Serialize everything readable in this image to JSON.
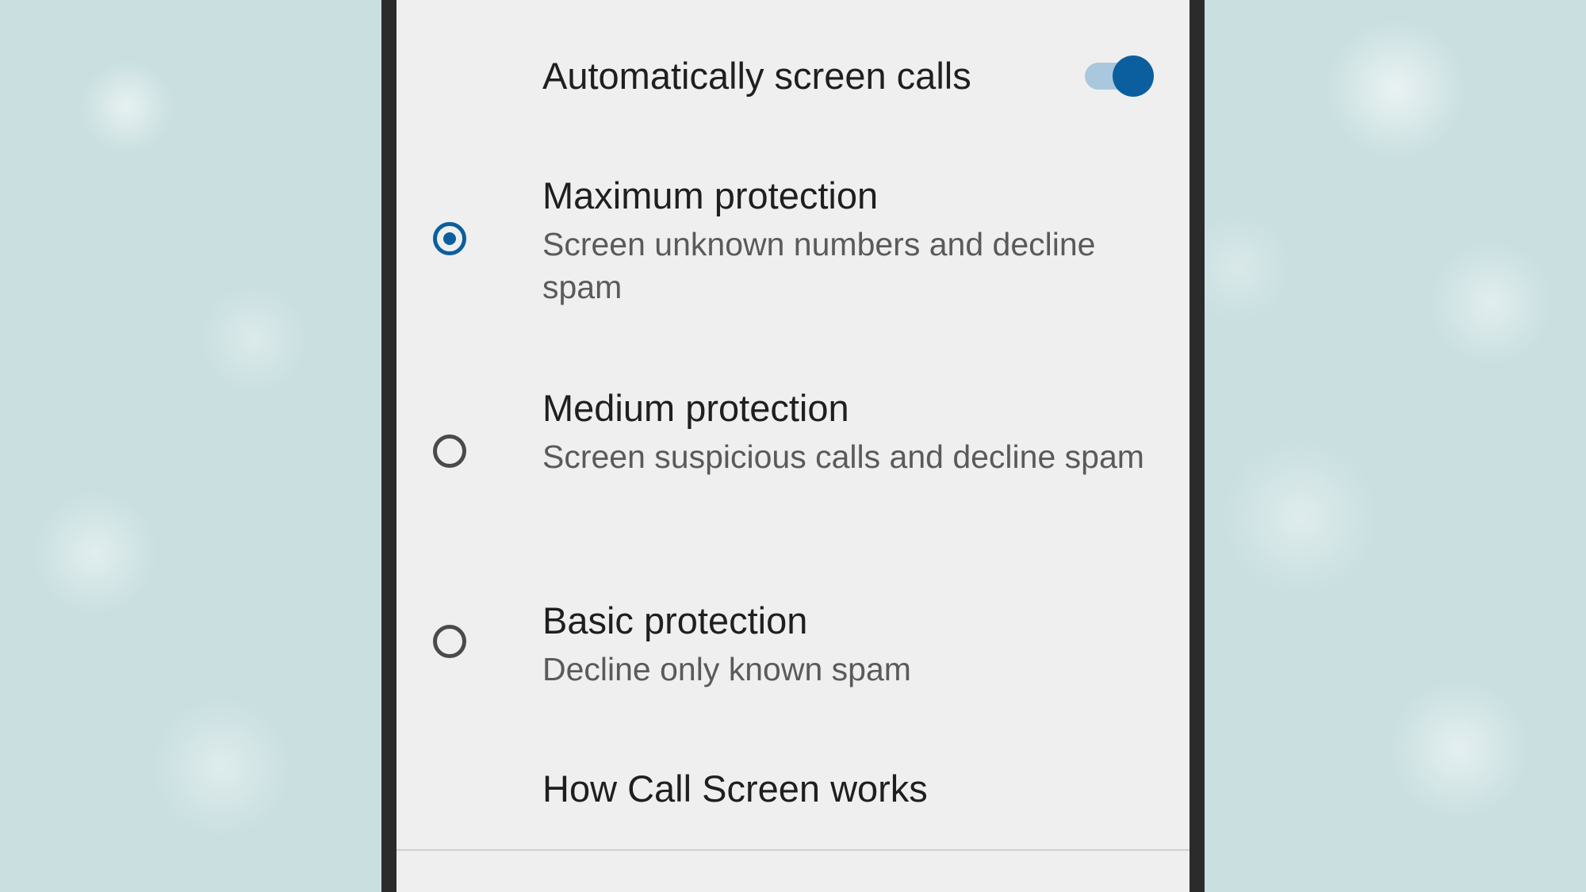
{
  "settings": {
    "auto_screen": {
      "label": "Automatically screen calls",
      "enabled": true
    },
    "options": [
      {
        "title": "Maximum protection",
        "description": "Screen unknown numbers and decline spam",
        "selected": true
      },
      {
        "title": "Medium protection",
        "description": "Screen suspicious calls and decline spam",
        "selected": false
      },
      {
        "title": "Basic protection",
        "description": "Decline only known spam",
        "selected": false
      }
    ],
    "help_link": "How Call Screen works"
  },
  "colors": {
    "accent": "#0b5f9e",
    "toggle_track": "#a9c8dd",
    "background": "#efefef",
    "title_text": "#1f1f1f",
    "subtitle_text": "#5a5a5a"
  }
}
